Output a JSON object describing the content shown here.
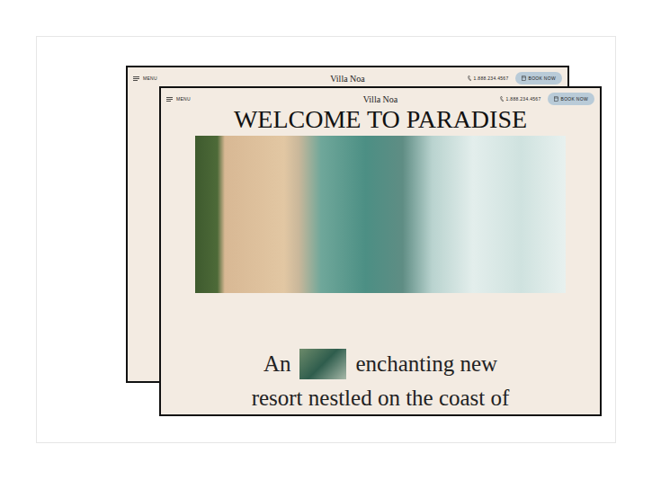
{
  "back_page": {
    "header": {
      "menu_label": "MENU",
      "title": "Villa Noa",
      "phone": "1.888.234.4567",
      "book_button": "BOOK NOW"
    }
  },
  "front_page": {
    "header": {
      "menu_label": "MENU",
      "title": "Villa Noa",
      "phone": "1.888.234.4567",
      "book_button": "BOOK NOW"
    },
    "hero_title": "WELCOME TO PARADISE",
    "intro_lines": [
      "An",
      "enchanting new",
      "resort nestled on the coast of"
    ]
  }
}
